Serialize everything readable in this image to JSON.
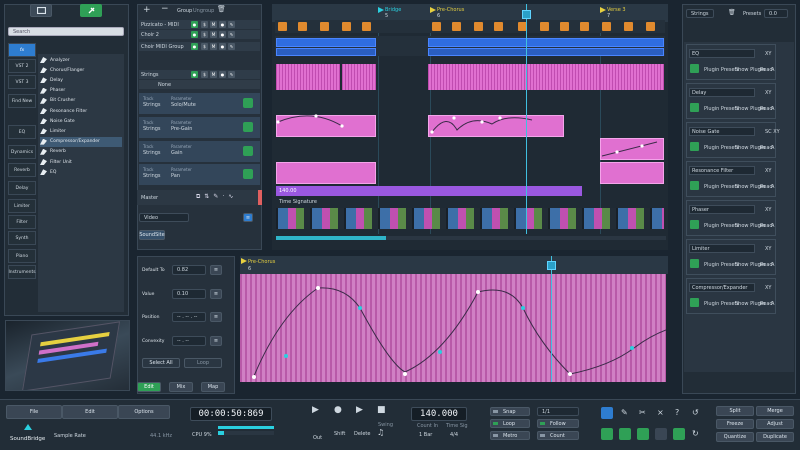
{
  "left": {
    "search_placeholder": "Search",
    "tabs": [
      "fx",
      "VST 2",
      "VST 3",
      "Find New",
      "EQ",
      "Dynamics",
      "Reverb",
      "Delay",
      "Limiter",
      "Filter",
      "Synth",
      "Piano",
      "Instruments"
    ],
    "effects": [
      "Analyzer",
      "Chorus/Flanger",
      "Delay",
      "Phaser",
      "Bit Crusher",
      "Resonance Filter",
      "Noise Gate",
      "Limiter",
      "Compressor/Expander",
      "Reverb",
      "Filter Unit",
      "EQ"
    ],
    "selected_effect": "Compressor/Expander"
  },
  "tracks": {
    "toolbar": {
      "group": "Group",
      "ungroup": "Ungroup"
    },
    "items": [
      {
        "name": "Pizzicato - MIDI"
      },
      {
        "name": "Choir 2"
      },
      {
        "name": "Choir MIDI Group"
      },
      {
        "name": "Strings"
      }
    ],
    "strings_param": "None",
    "automation": [
      {
        "track_label": "Track",
        "track": "Strings",
        "param_label": "Parameter",
        "param": "Solo/Mute"
      },
      {
        "track_label": "Track",
        "track": "Strings",
        "param_label": "Parameter",
        "param": "Pre-Gain"
      },
      {
        "track_label": "Track",
        "track": "Strings",
        "param_label": "Parameter",
        "param": "Gain"
      },
      {
        "track_label": "Track",
        "track": "Strings",
        "param_label": "Parameter",
        "param": "Pan"
      }
    ],
    "master": "Master",
    "video": "Video",
    "soundsite": "SoundSite"
  },
  "arrange": {
    "markers": [
      {
        "label": "Bridge",
        "num": "5"
      },
      {
        "label": "Pre-Chorus",
        "num": "6"
      },
      {
        "label": "Verse 3",
        "num": "7"
      }
    ],
    "tempo_value": "140.00",
    "time_signature": "Time Signature"
  },
  "editor": {
    "default_to_label": "Default To",
    "default_to": "0.82",
    "value_label": "Value",
    "value": "0.10",
    "position_label": "Position",
    "position": "-- . -- . --",
    "convexity_label": "Convexity",
    "convexity": "-- . --",
    "select_all": "Select All",
    "loop": "Loop",
    "tabs": [
      "Edit",
      "Mix",
      "Map"
    ],
    "marker": {
      "label": "Pre-Chorus",
      "num": "6"
    }
  },
  "right": {
    "strings": "Strings",
    "presets": "Presets",
    "presets_value": "0.0",
    "cards": [
      {
        "name": "EQ",
        "tag": "XY"
      },
      {
        "name": "Delay",
        "tag": "XY"
      },
      {
        "name": "Noise Gate",
        "tag": "SC XY"
      },
      {
        "name": "Resonance Filter",
        "tag": "XY"
      },
      {
        "name": "Phaser",
        "tag": "XY"
      },
      {
        "name": "Limiter",
        "tag": "XY"
      },
      {
        "name": "Compressor/Expander",
        "tag": "XY"
      }
    ],
    "plugin_presets": "Plugin Presets",
    "show_plugin": "Show Plugin",
    "read": "Read",
    "a": "A"
  },
  "transport": {
    "file": "File",
    "edit": "Edit",
    "options": "Options",
    "logo": "SoundBridge",
    "sample_rate_label": "Sample Rate",
    "sample_rate": "44.1 kHz",
    "time": "00:00:50:869",
    "cpu": "CPU 9%",
    "out": "Out",
    "shift": "Shift",
    "delete": "Delete",
    "swing": "Swing",
    "tempo": "140.000",
    "count_in_label": "Count In",
    "count_in": "1 Bar",
    "time_sig_label": "Time Sig",
    "time_sig": "4/4",
    "snap": "Snap",
    "grid": "1/1",
    "loop": "Loop",
    "follow": "Follow",
    "metro": "Metro",
    "count": "Count",
    "split": "Split",
    "merge": "Merge",
    "freeze": "Freeze",
    "adjust": "Adjust",
    "quantize": "Quantize",
    "duplicate": "Duplicate"
  }
}
